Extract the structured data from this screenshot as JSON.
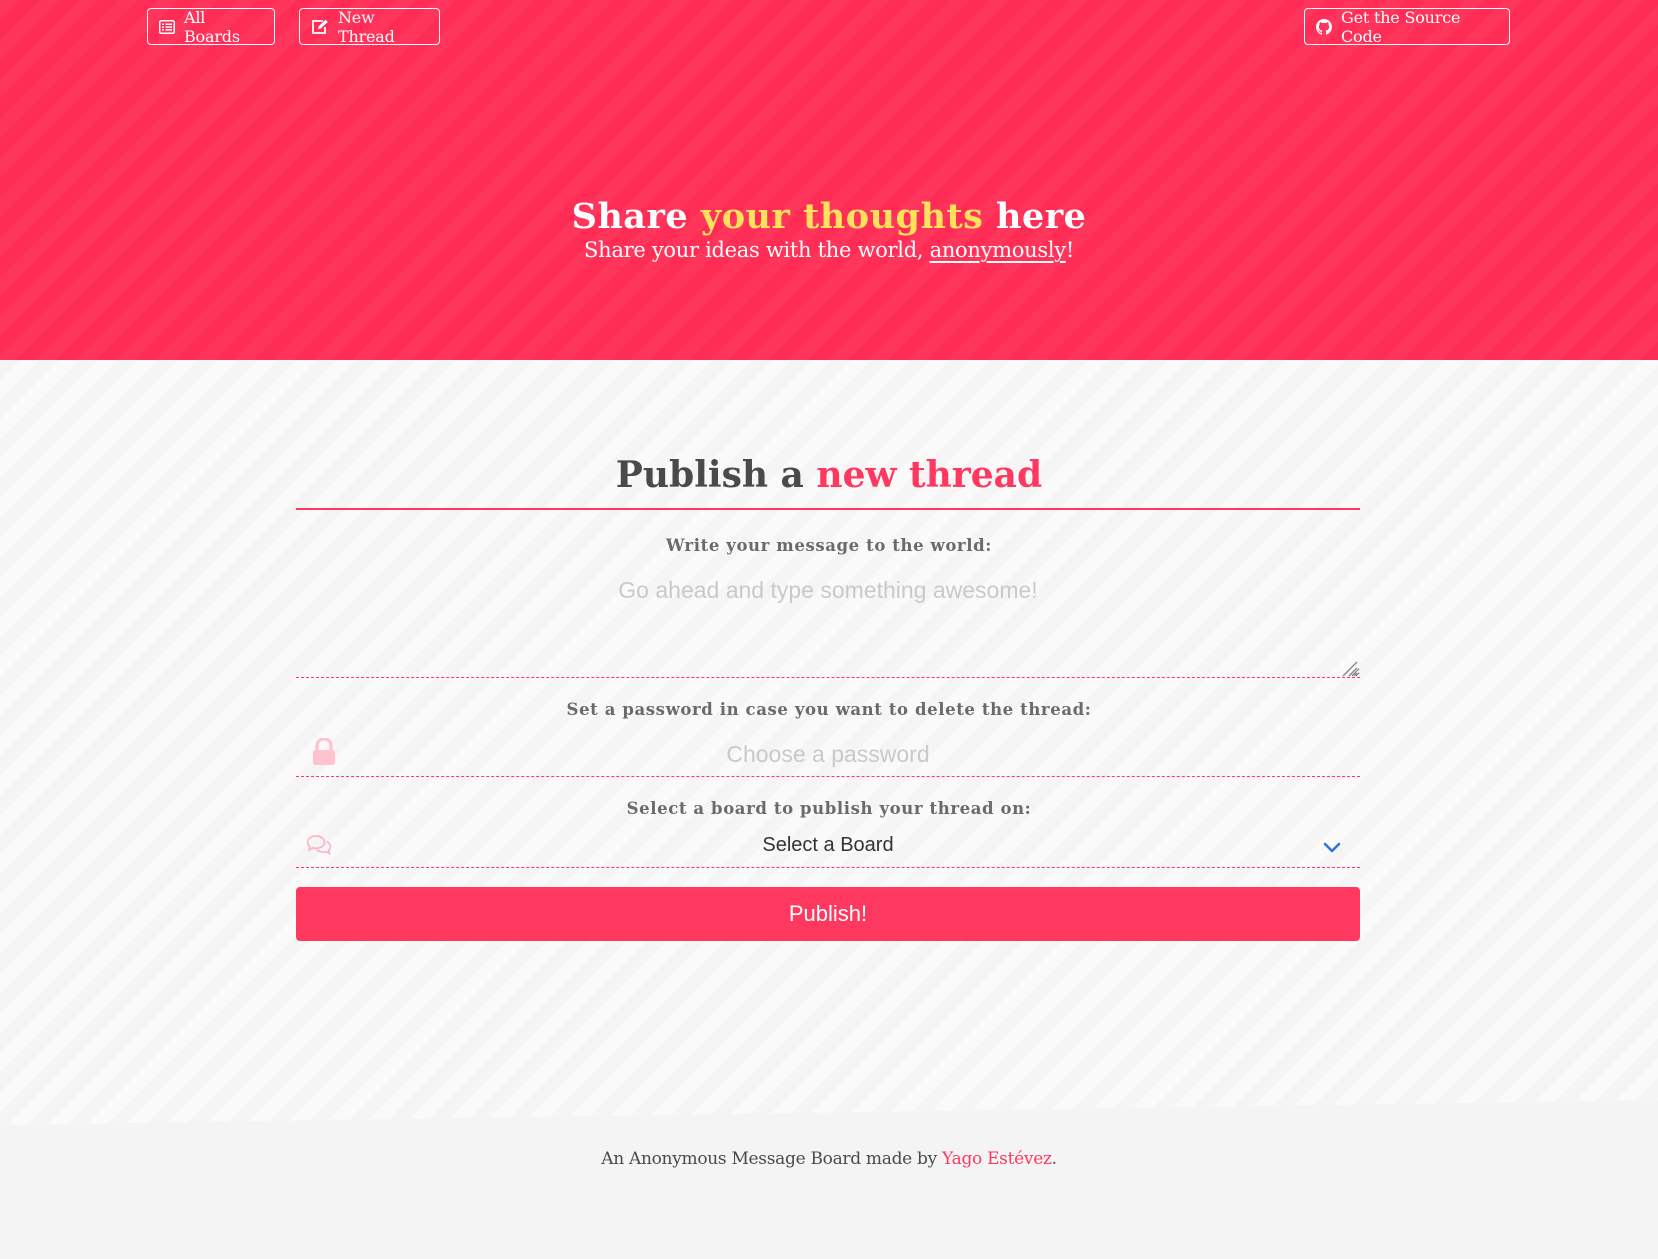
{
  "nav": {
    "all_boards": "All Boards",
    "new_thread": "New Thread",
    "source_code": "Get the Source Code"
  },
  "hero": {
    "title_pre": "Share ",
    "title_highlight": "your thoughts",
    "title_post": " here",
    "subtitle_pre": "Share your ideas with the world, ",
    "subtitle_link": "anonymously",
    "subtitle_post": "!"
  },
  "form": {
    "title_pre": "Publish a ",
    "title_highlight": "new thread",
    "message_label": "Write your message to the world:",
    "message_placeholder": "Go ahead and type something awesome!",
    "password_label": "Set a password in case you want to delete the thread:",
    "password_placeholder": "Choose a password",
    "board_label": "Select a board to publish your thread on:",
    "board_selected": "Select a Board",
    "publish_label": "Publish!"
  },
  "footer": {
    "text_pre": "An Anonymous Message Board made by ",
    "author": "Yago Estévez",
    "text_post": "."
  },
  "colors": {
    "brand": "#ff3860",
    "hero_bg": "#ff2c55",
    "highlight": "#ffe15c"
  },
  "icons": [
    "list-icon",
    "edit-icon",
    "github-icon",
    "lock-icon",
    "chat-icon",
    "chevron-down-icon"
  ]
}
